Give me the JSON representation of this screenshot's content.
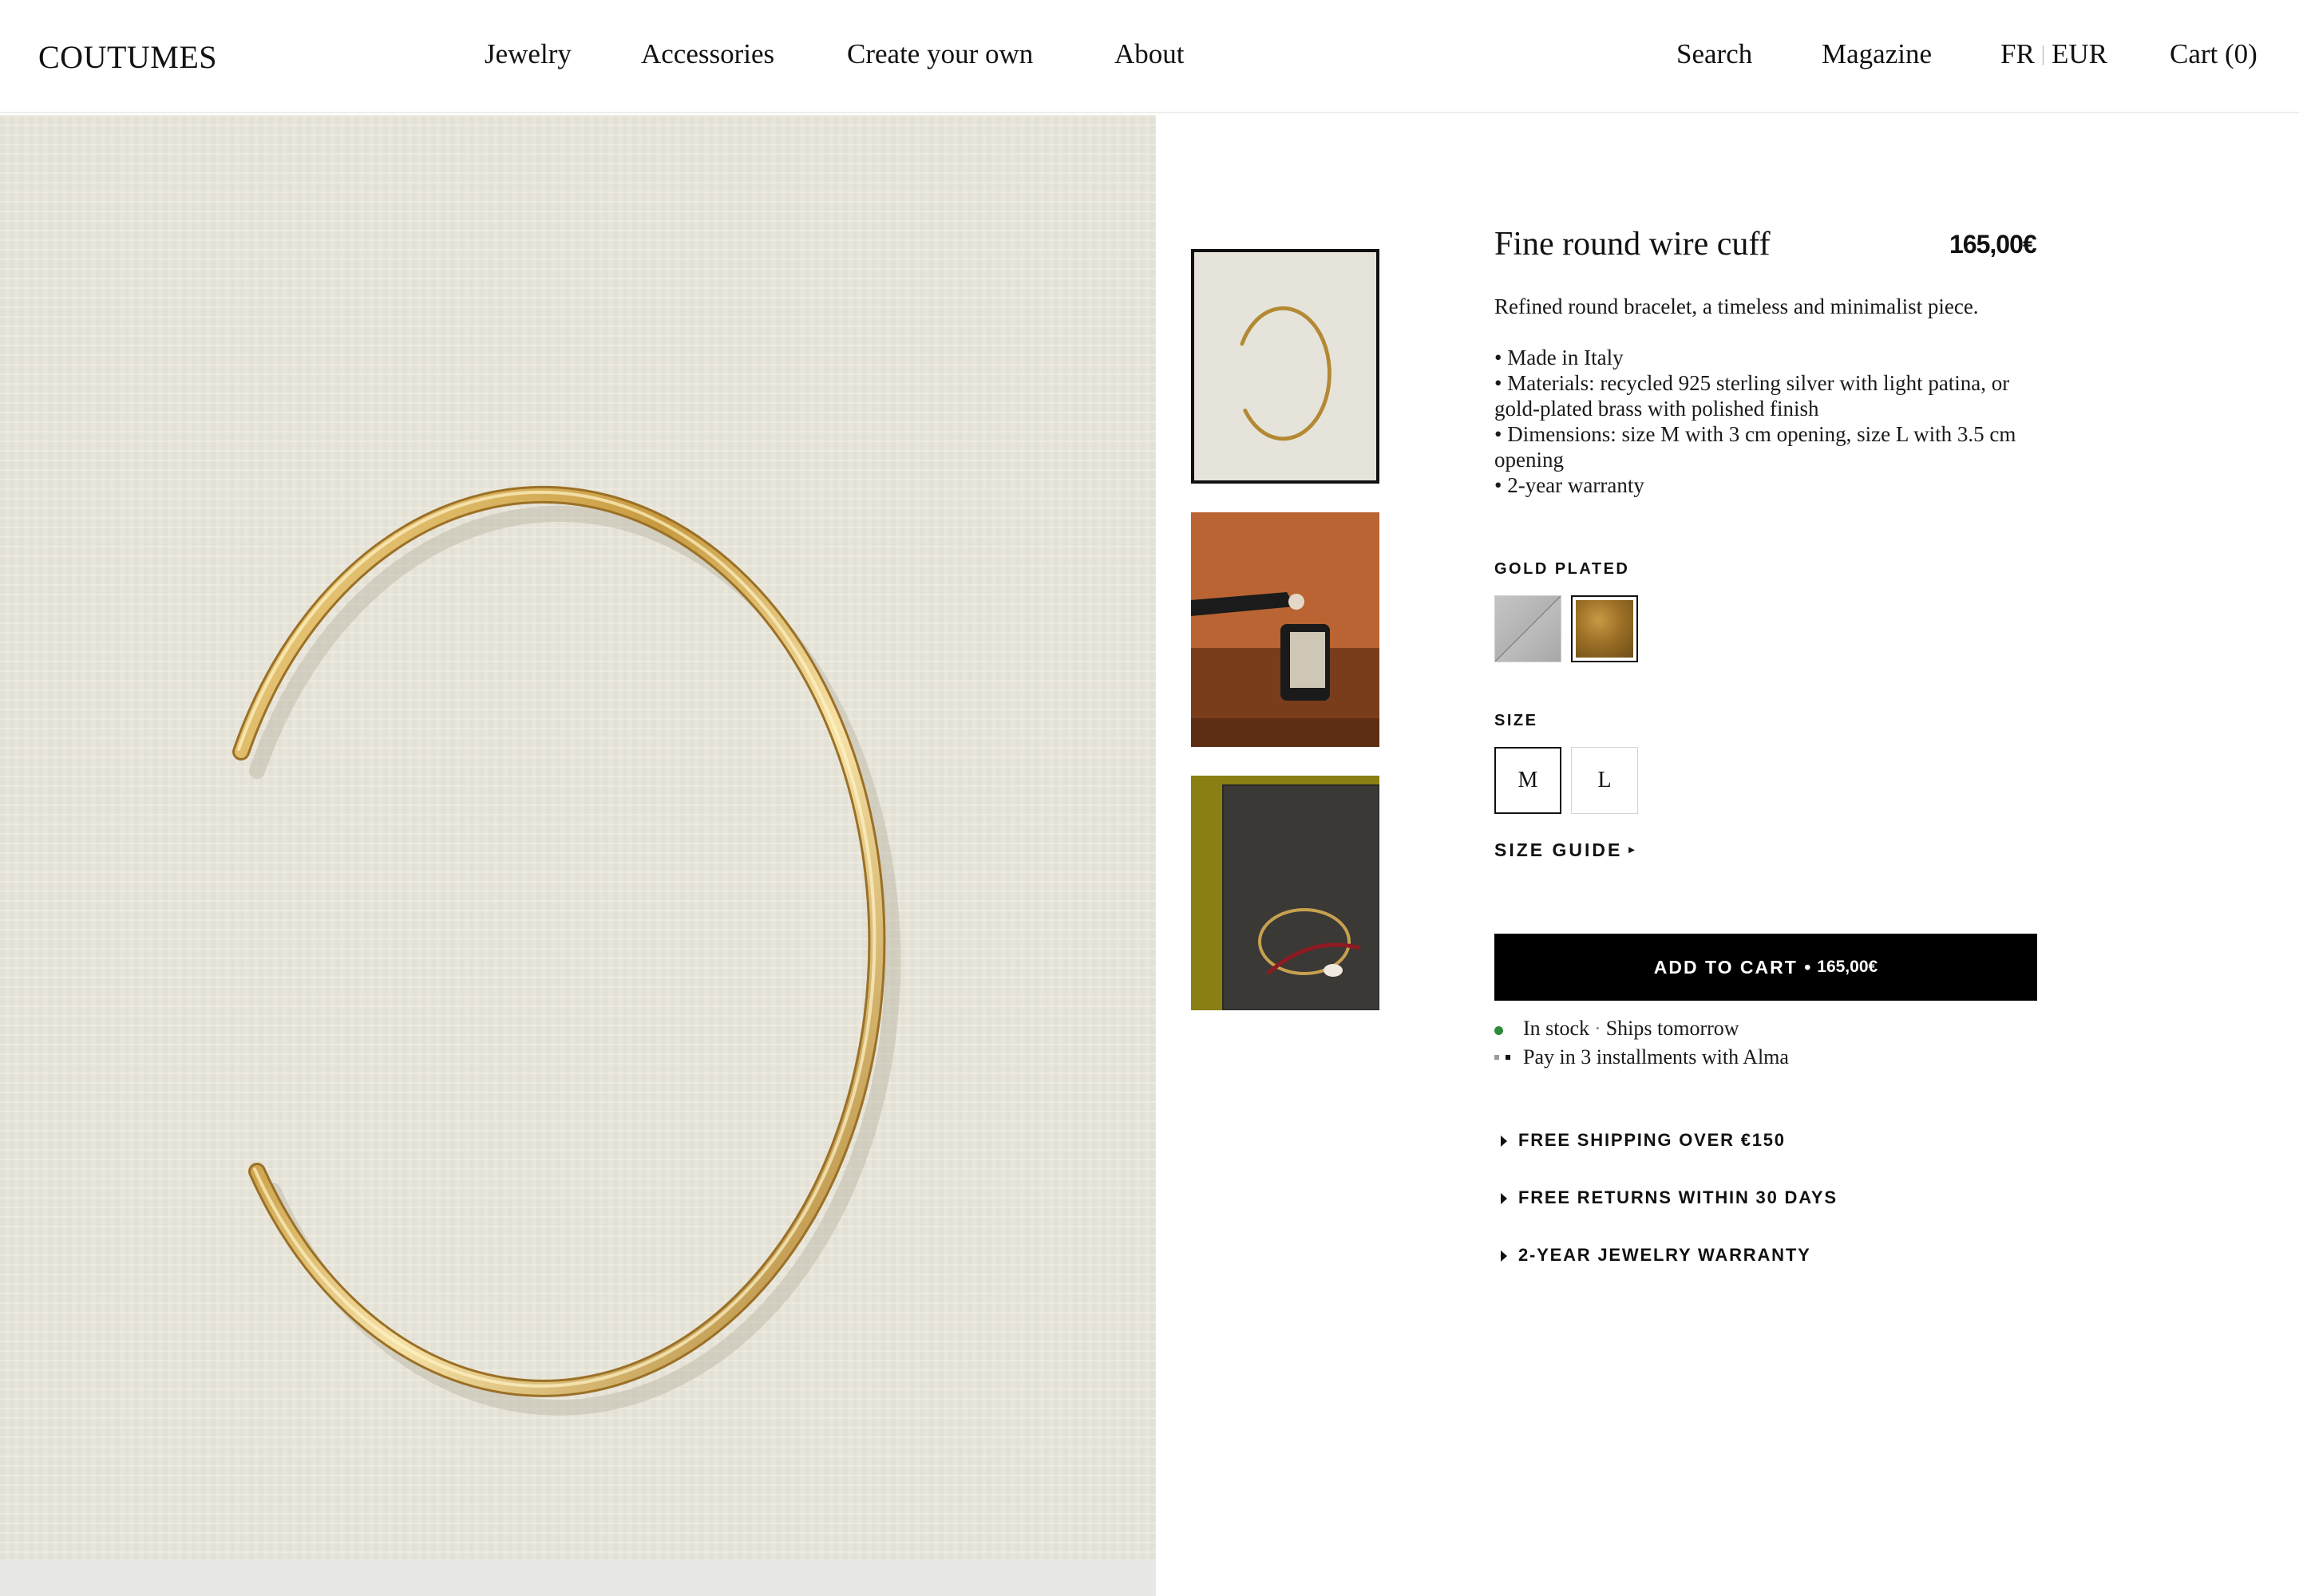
{
  "header": {
    "logo": "COUTUMES",
    "nav": [
      "Jewelry",
      "Accessories",
      "Create your own",
      "About"
    ],
    "search": "Search",
    "magazine": "Magazine",
    "lang": "FR",
    "lang_sep": "|",
    "currency": "EUR",
    "cart": "Cart (0)"
  },
  "product": {
    "title": "Fine round wire cuff",
    "price": "165,00€",
    "description": "Refined round bracelet, a timeless and minimalist piece.",
    "bullets": [
      "• Made in Italy",
      "• Materials: recycled 925 sterling silver with light patina, or gold-plated brass with polished finish",
      "• Dimensions: size M with 3 cm opening, size L with 3.5 cm opening",
      "• 2-year warranty"
    ]
  },
  "variant": {
    "label": "GOLD PLATED",
    "options": [
      "silver",
      "gold plated"
    ],
    "selected": "gold plated"
  },
  "size": {
    "label": "SIZE",
    "options": [
      "M",
      "L"
    ],
    "selected": "M",
    "guide": "SIZE GUIDE",
    "guide_icon": "chevron-right-icon"
  },
  "cart_button": {
    "label": "ADD TO CART •",
    "price": "165,00€"
  },
  "status": {
    "stock": "In stock",
    "sep": "·",
    "shipping": "Ships tomorrow",
    "installments": "Pay in 3 installments with Alma",
    "stock_color": "#2f8a3b"
  },
  "accordions": [
    "FREE SHIPPING OVER €150",
    "FREE RETURNS WITHIN 30 DAYS",
    "2-YEAR JEWELRY WARRANTY"
  ],
  "colors": {
    "accent": "#000000",
    "gold": "#c89a45",
    "background_paper": "#e9e7dd"
  }
}
